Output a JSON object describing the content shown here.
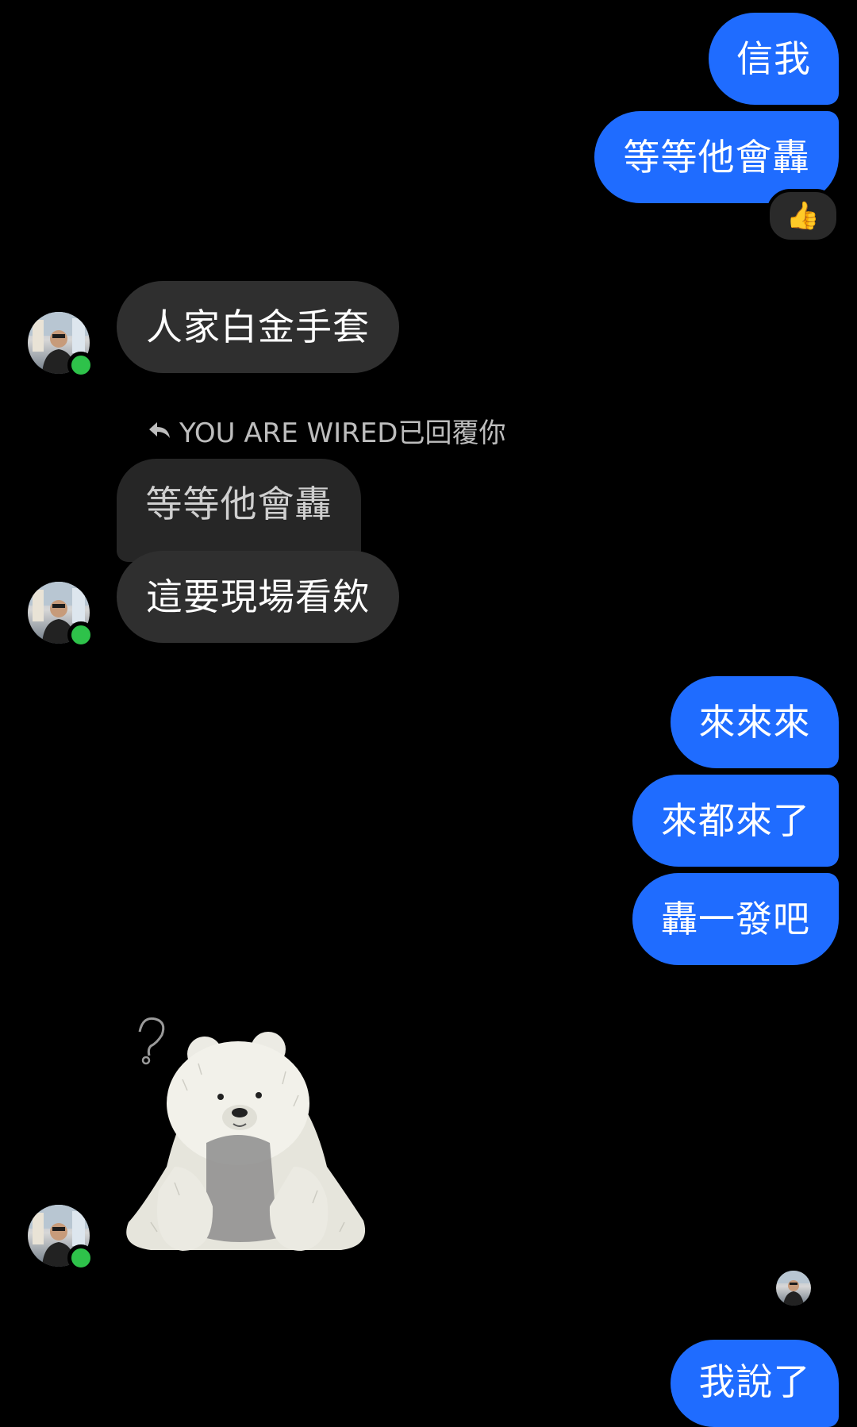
{
  "messages": {
    "out1": "信我",
    "out2": "等等他會轟",
    "in1": "人家白金手套",
    "reply_label": "YOU ARE WIRED已回覆你",
    "quoted": "等等他會轟",
    "in2": "這要現場看欸",
    "out3": "來來來",
    "out4": "來都來了",
    "out5": "轟一發吧",
    "out6": "我說了"
  },
  "reaction": {
    "icon": "thumbs-up-icon",
    "emoji": "👍"
  },
  "colors": {
    "outgoing": "#1f6cff",
    "incoming": "#2f2f2f",
    "online": "#2ec24a"
  }
}
